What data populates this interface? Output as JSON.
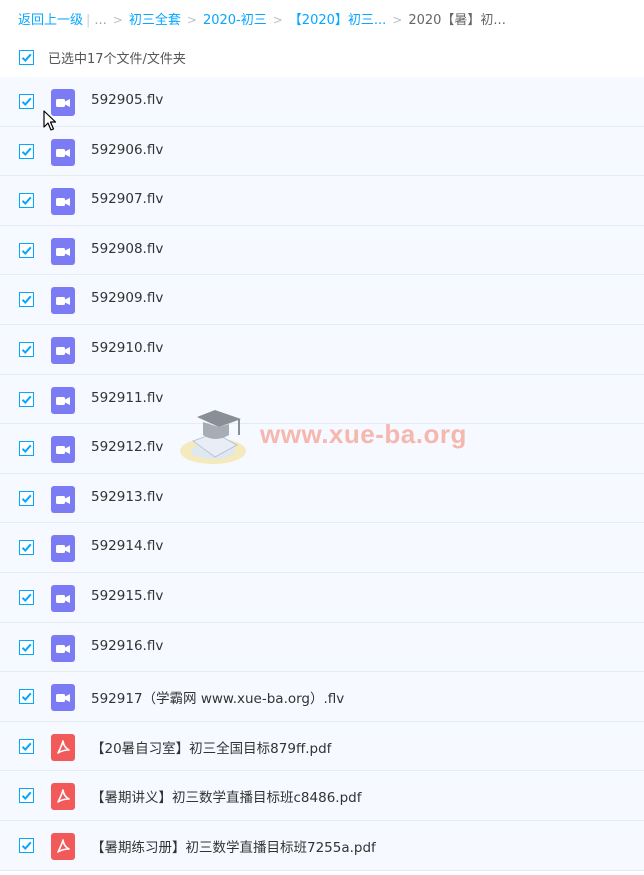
{
  "breadcrumb": {
    "back": "返回上一级",
    "ellipsis": "...",
    "items": [
      "初三全套",
      "2020-初三",
      "【2020】初三..."
    ],
    "current": "2020【暑】初..."
  },
  "selection": {
    "label": "已选中17个文件/文件夹"
  },
  "files": [
    {
      "name": "592905.flv",
      "type": "video"
    },
    {
      "name": "592906.flv",
      "type": "video"
    },
    {
      "name": "592907.flv",
      "type": "video"
    },
    {
      "name": "592908.flv",
      "type": "video"
    },
    {
      "name": "592909.flv",
      "type": "video"
    },
    {
      "name": "592910.flv",
      "type": "video"
    },
    {
      "name": "592911.flv",
      "type": "video"
    },
    {
      "name": "592912.flv",
      "type": "video"
    },
    {
      "name": "592913.flv",
      "type": "video"
    },
    {
      "name": "592914.flv",
      "type": "video"
    },
    {
      "name": "592915.flv",
      "type": "video"
    },
    {
      "name": "592916.flv",
      "type": "video"
    },
    {
      "name": "592917（学霸网 www.xue-ba.org）.flv",
      "type": "video"
    },
    {
      "name": "【20暑自习室】初三全国目标879ff.pdf",
      "type": "pdf"
    },
    {
      "name": "【暑期讲义】初三数学直播目标班c8486.pdf",
      "type": "pdf"
    },
    {
      "name": "【暑期练习册】初三数学直播目标班7255a.pdf",
      "type": "pdf"
    }
  ],
  "watermark": {
    "text": "www.xue-ba.org"
  },
  "colors": {
    "accent": "#06a7ff",
    "video_icon": "#7b7cf3",
    "pdf_icon": "#f25a5a",
    "row_bg": "#f6f9ff"
  }
}
